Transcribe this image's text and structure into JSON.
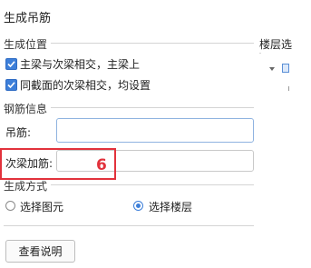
{
  "dialog": {
    "title": "生成吊筋"
  },
  "position_group": {
    "label": "生成位置",
    "options": [
      {
        "label": "主梁与次梁相交，主梁上",
        "checked": true
      },
      {
        "label": "同截面的次梁相交，均设置",
        "checked": true
      }
    ]
  },
  "rebar_group": {
    "label": "钢筋信息",
    "hanger_label": "吊筋:",
    "hanger_value": "",
    "secondary_label": "次梁加筋:",
    "secondary_value": ""
  },
  "annotation": {
    "number": "6",
    "color": "#e2323c"
  },
  "method_group": {
    "label": "生成方式",
    "options": [
      {
        "label": "选择图元",
        "selected": false
      },
      {
        "label": "选择楼层",
        "selected": true
      }
    ]
  },
  "help_button": {
    "label": "查看说明"
  },
  "floor_panel": {
    "title": "楼层选"
  },
  "colors": {
    "accent": "#3d7fd9",
    "highlight": "#e2323c"
  }
}
